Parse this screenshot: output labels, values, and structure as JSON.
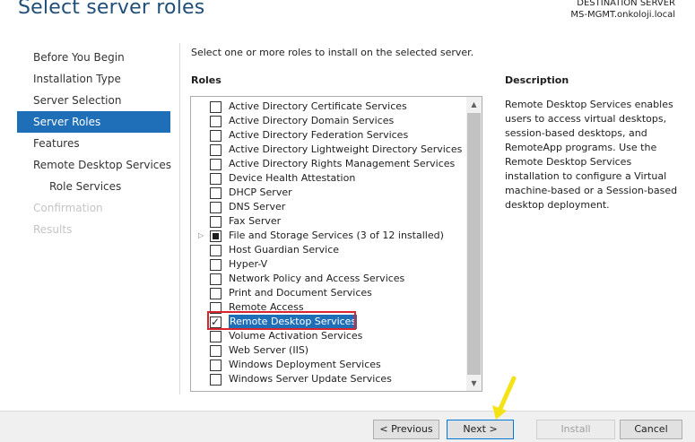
{
  "header": {
    "title": "Select server roles",
    "destination_label": "DESTINATION SERVER",
    "destination_server": "MS-MGMT.onkoloji.local"
  },
  "nav": {
    "items": [
      {
        "label": "Before You Begin",
        "state": "normal"
      },
      {
        "label": "Installation Type",
        "state": "normal"
      },
      {
        "label": "Server Selection",
        "state": "normal"
      },
      {
        "label": "Server Roles",
        "state": "active"
      },
      {
        "label": "Features",
        "state": "normal"
      },
      {
        "label": "Remote Desktop Services",
        "state": "normal"
      },
      {
        "label": "Role Services",
        "state": "sub"
      },
      {
        "label": "Confirmation",
        "state": "disabled"
      },
      {
        "label": "Results",
        "state": "disabled"
      }
    ]
  },
  "main": {
    "instruction": "Select one or more roles to install on the selected server.",
    "roles_heading": "Roles",
    "roles": [
      {
        "label": "Active Directory Certificate Services",
        "state": "unchecked"
      },
      {
        "label": "Active Directory Domain Services",
        "state": "unchecked"
      },
      {
        "label": "Active Directory Federation Services",
        "state": "unchecked"
      },
      {
        "label": "Active Directory Lightweight Directory Services",
        "state": "unchecked"
      },
      {
        "label": "Active Directory Rights Management Services",
        "state": "unchecked"
      },
      {
        "label": "Device Health Attestation",
        "state": "unchecked"
      },
      {
        "label": "DHCP Server",
        "state": "unchecked"
      },
      {
        "label": "DNS Server",
        "state": "unchecked"
      },
      {
        "label": "Fax Server",
        "state": "unchecked"
      },
      {
        "label": "File and Storage Services (3 of 12 installed)",
        "state": "partial"
      },
      {
        "label": "Host Guardian Service",
        "state": "unchecked"
      },
      {
        "label": "Hyper-V",
        "state": "unchecked"
      },
      {
        "label": "Network Policy and Access Services",
        "state": "unchecked"
      },
      {
        "label": "Print and Document Services",
        "state": "unchecked"
      },
      {
        "label": "Remote Access",
        "state": "unchecked"
      },
      {
        "label": "Remote Desktop Services",
        "state": "checked"
      },
      {
        "label": "Volume Activation Services",
        "state": "unchecked"
      },
      {
        "label": "Web Server (IIS)",
        "state": "unchecked"
      },
      {
        "label": "Windows Deployment Services",
        "state": "unchecked"
      },
      {
        "label": "Windows Server Update Services",
        "state": "unchecked"
      }
    ],
    "description_heading": "Description",
    "description_text": "Remote Desktop Services enables users to access virtual desktops, session-based desktops, and RemoteApp programs. Use the Remote Desktop Services installation to configure a Virtual machine-based or a Session-based desktop deployment."
  },
  "footer": {
    "previous_label": "< Previous",
    "next_label": "Next >",
    "install_label": "Install",
    "cancel_label": "Cancel"
  },
  "colors": {
    "accent": "#1f6fb8",
    "title": "#1f4e79",
    "highlight_border": "#d9262e",
    "arrow": "#f5e214"
  }
}
